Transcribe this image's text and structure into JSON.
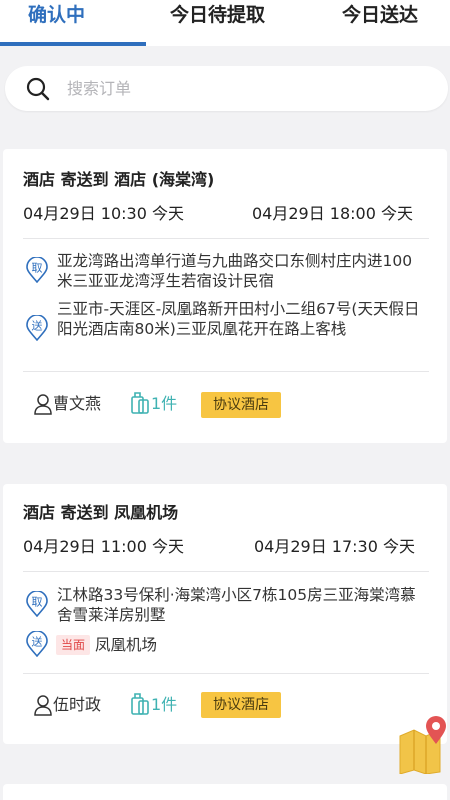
{
  "tabs": [
    {
      "label": "确认中"
    },
    {
      "label": "今日待提取"
    },
    {
      "label": "今日送达"
    }
  ],
  "search": {
    "placeholder": "搜索订单"
  },
  "orders": [
    {
      "title": "酒店 寄送到 酒店 (海棠湾)",
      "pickup_time": "04月29日 10:30 今天",
      "delivery_time": "04月29日 18:00 今天",
      "pickup_icon_label": "取",
      "pickup_address": "亚龙湾路出湾单行道与九曲路交口东侧村庄内进100米三亚亚龙湾浮生若宿设计民宿",
      "delivery_icon_label": "送",
      "delivery_address": "三亚市-天涯区-凤凰路新开田村小二组67号(天天假日阳光酒店南80米)三亚凤凰花开在路上客栈",
      "person": "曹文燕",
      "count": "1件",
      "tag": "协议酒店"
    },
    {
      "title": "酒店 寄送到 凤凰机场",
      "pickup_time": "04月29日 11:00 今天",
      "delivery_time": "04月29日 17:30 今天",
      "pickup_icon_label": "取",
      "pickup_address": "江林路33号保利·海棠湾小区7栋105房三亚海棠湾慕舍雪莱洋房别墅",
      "delivery_icon_label": "送",
      "delivery_badge": "当面",
      "delivery_address": "凤凰机场",
      "person": "伍时政",
      "count": "1件",
      "tag": "协议酒店"
    }
  ],
  "colors": {
    "accent": "#2f6fbd",
    "tag_bg": "#f7c542",
    "count_color": "#3fb2b2",
    "face_badge_bg": "#fde6e6",
    "face_badge_text": "#e04848"
  }
}
